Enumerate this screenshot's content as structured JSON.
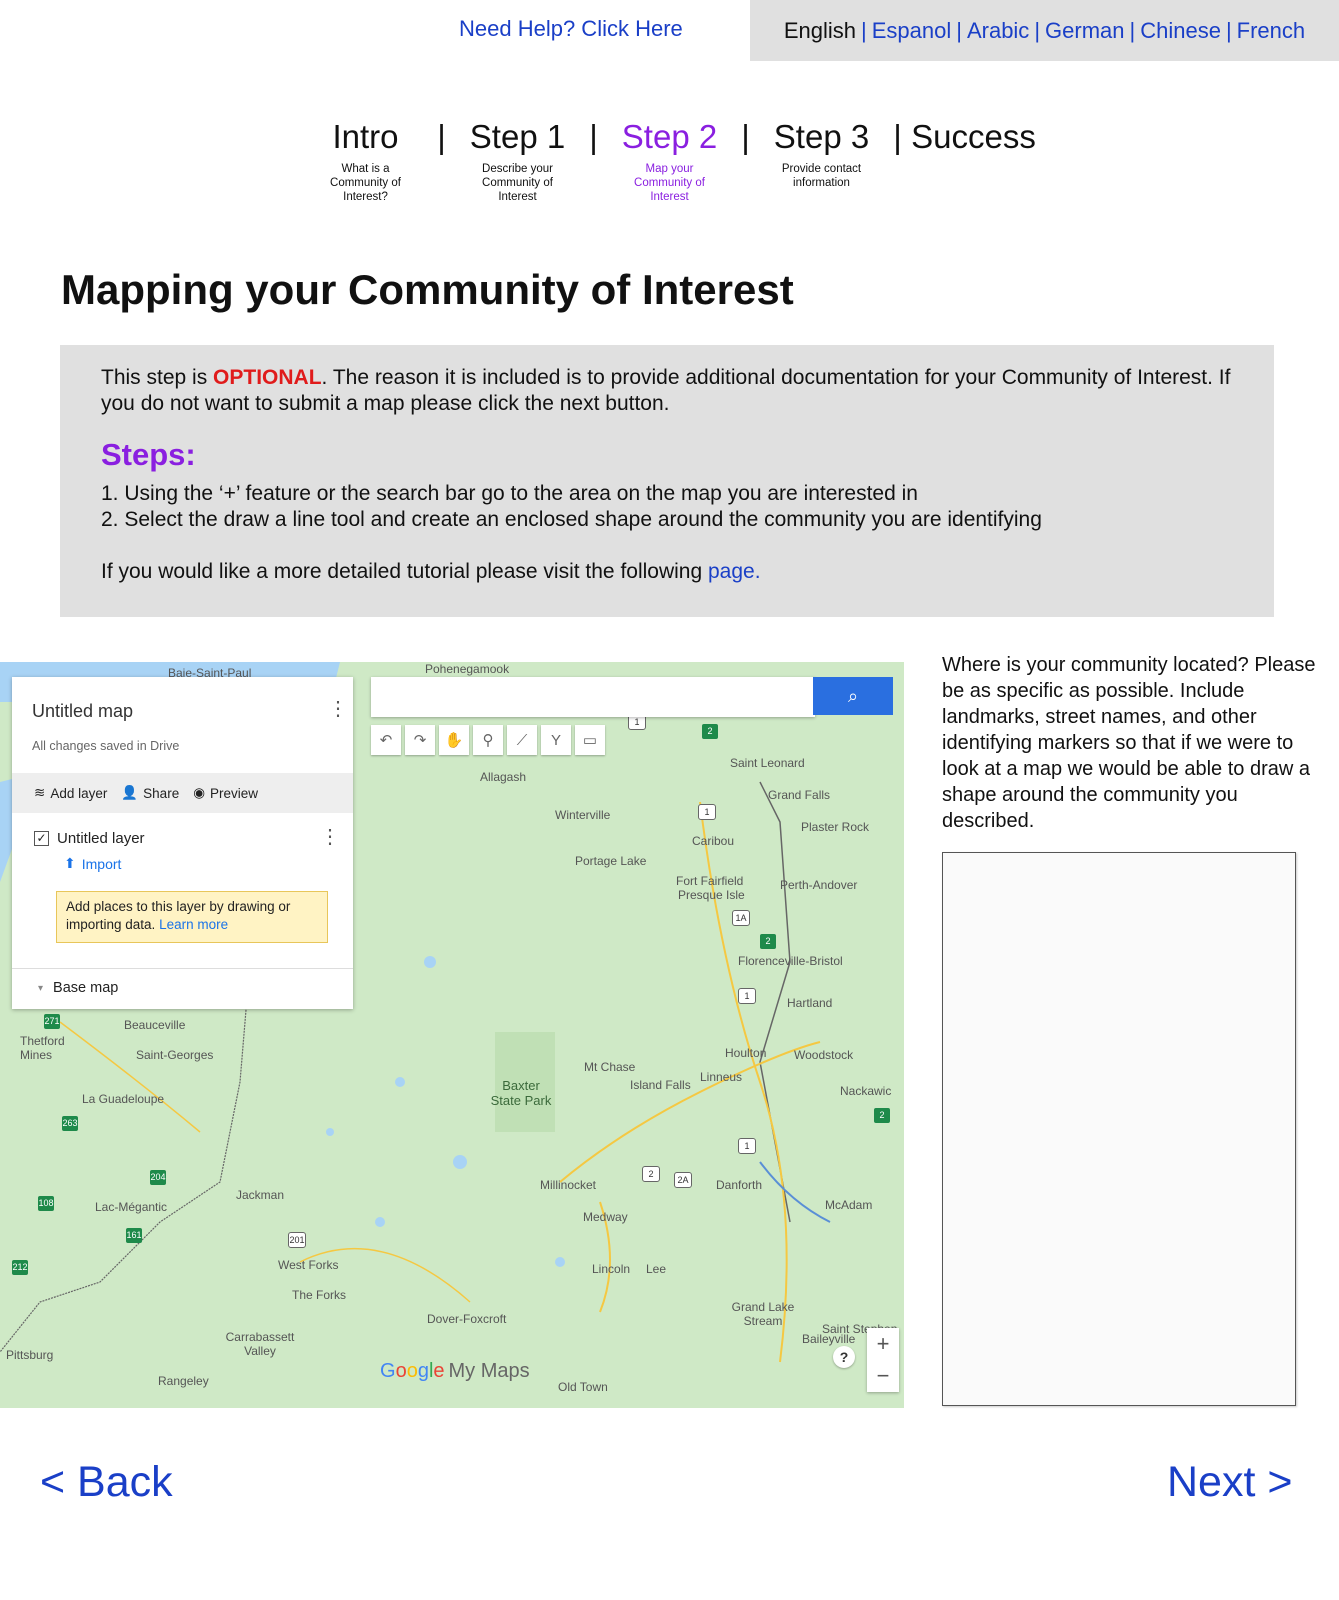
{
  "header": {
    "help_link": "Need Help? Click Here",
    "languages": [
      {
        "label": "English",
        "current": true
      },
      {
        "label": "Espanol",
        "current": false
      },
      {
        "label": "Arabic",
        "current": false
      },
      {
        "label": "German",
        "current": false
      },
      {
        "label": "Chinese",
        "current": false
      },
      {
        "label": "French",
        "current": false
      }
    ],
    "lang_separator": "|"
  },
  "steps_nav": {
    "separator": "|",
    "active_color": "#8a1fe0",
    "items": [
      {
        "label": "Intro",
        "sub": "What is a Community of Interest?"
      },
      {
        "label": "Step 1",
        "sub": "Describe your Community of Interest"
      },
      {
        "label": "Step 2",
        "sub": "Map your Community of Interest",
        "active": true
      },
      {
        "label": "Step 3",
        "sub": "Provide contact information"
      },
      {
        "label": "Success",
        "sub": ""
      }
    ]
  },
  "page_title": "Mapping your Community of Interest",
  "info": {
    "intro_pre": "This step is ",
    "intro_optional": "OPTIONAL",
    "intro_post": ". The reason it is included is to provide additional documentation for your Community of Interest. If you do not want to submit a map please click the next button.",
    "steps_heading": "Steps:",
    "step_1": "1. Using the ‘+’ feature or the search bar go to the area on the map you are interested in",
    "step_2": "2. Select the draw a  line tool and create an enclosed shape around the community you are identifying",
    "tutorial_pre": "If you would like a more detailed tutorial please visit the following ",
    "tutorial_link": "page.",
    "highlight_color": "#e01b1b"
  },
  "map": {
    "panel": {
      "title": "Untitled map",
      "saved": "All changes saved in Drive",
      "add_layer": "Add layer",
      "share": "Share",
      "preview": "Preview",
      "layer_name": "Untitled layer",
      "import": "Import",
      "tip_text": "Add places to this layer by drawing or importing data.",
      "tip_link": "Learn more",
      "base_map": "Base map"
    },
    "search_placeholder": "",
    "search_icon": "search-icon",
    "zoom_in": "+",
    "zoom_out": "−",
    "help": "?",
    "brand_google": [
      "G",
      "o",
      "o",
      "g",
      "l",
      "e"
    ],
    "brand_mymaps": "My Maps",
    "places": [
      "Baie-Saint-Paul",
      "Pohenegamook",
      "Allagash",
      "Winterville",
      "Saint Leonard",
      "Grand Falls",
      "Plaster Rock",
      "Caribou",
      "Portage Lake",
      "Fort Fairfield",
      "Presque Isle",
      "Perth-Andover",
      "Florenceville-Bristol",
      "Hartland",
      "Houlton",
      "Woodstock",
      "Nackawic",
      "Mt Chase",
      "Island Falls",
      "Linneus",
      "Baxter State Park",
      "Beauceville",
      "Thetford Mines",
      "Saint-Georges",
      "La Guadeloupe",
      "Jackman",
      "Lac-Mégantic",
      "Millinocket",
      "Medway",
      "Danforth",
      "McAdam",
      "West Forks",
      "The Forks",
      "Lincoln",
      "Lee",
      "Dover-Foxcroft",
      "Grand Lake Stream",
      "Saint Stephen",
      "Baileyville",
      "Carrabassett Valley",
      "Rangeley",
      "Pittsburg",
      "Old Town"
    ]
  },
  "community_prompt": "Where is your community located? Please be as specific as possible. Include landmarks, street names, and other identifying markers so that if we were to look at a map we would be able to draw a shape around the community you described.",
  "community_value": "",
  "nav": {
    "back": "< Back",
    "next": "Next >"
  }
}
